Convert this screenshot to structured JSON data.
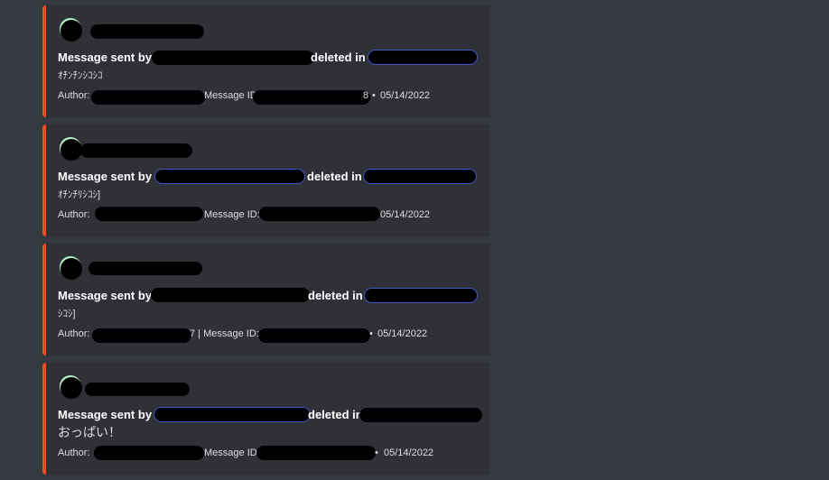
{
  "messages": [
    {
      "title_prefix": "Message sent by",
      "title_mid": "deleted in",
      "content": "ｵﾁﾝﾁﾝｼｺｼｺ",
      "author_label": "Author:",
      "message_id_label": "Message ID",
      "id_tail": "8",
      "separator": "•",
      "date": "05/14/2022"
    },
    {
      "title_prefix": "Message sent by",
      "title_mid": "deleted in",
      "content": "ｵﾁﾝﾁﾘｼｺｼ]",
      "author_label": "Author:",
      "message_id_label": "Message ID:",
      "separator": "•",
      "date": "05/14/2022"
    },
    {
      "title_prefix": "Message sent by",
      "title_mid": "deleted in",
      "content": "ｼｺｼ]",
      "author_label": "Author:",
      "author_tail": "7 | Message ID:",
      "separator": "•",
      "date": "05/14/2022"
    },
    {
      "title_prefix": "Message sent by",
      "title_mid": "deleted in",
      "content": "おっぱい！",
      "author_label": "Author:",
      "message_id_label": "Message ID",
      "separator": "•",
      "date": "05/14/2022"
    }
  ],
  "colors": {
    "background": "#36393f",
    "embed_background": "#2f3136",
    "embed_accent": "#f04d23",
    "redaction": "#000000"
  }
}
